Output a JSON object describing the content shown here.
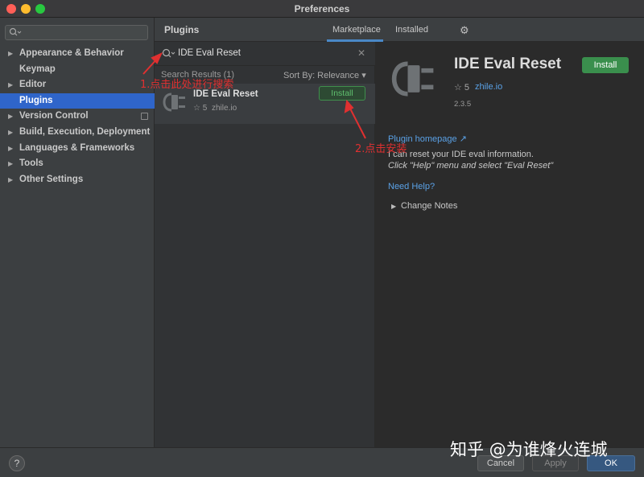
{
  "window": {
    "title": "Preferences"
  },
  "sidebar": {
    "search": {
      "value": ""
    },
    "items": [
      {
        "label": "Appearance & Behavior",
        "expandable": true
      },
      {
        "label": "Keymap",
        "expandable": false
      },
      {
        "label": "Editor",
        "expandable": true
      },
      {
        "label": "Plugins",
        "expandable": false,
        "active": true
      },
      {
        "label": "Version Control",
        "expandable": true
      },
      {
        "label": "Build, Execution, Deployment",
        "expandable": true
      },
      {
        "label": "Languages & Frameworks",
        "expandable": true
      },
      {
        "label": "Tools",
        "expandable": true
      },
      {
        "label": "Other Settings",
        "expandable": true
      }
    ]
  },
  "header": {
    "title": "Plugins",
    "tabs": [
      {
        "label": "Marketplace",
        "active": true
      },
      {
        "label": "Installed",
        "active": false
      }
    ]
  },
  "plugin_search": {
    "value": "IDE Eval Reset"
  },
  "results": {
    "count_label": "Search Results (1)",
    "sort_label": "Sort By: Relevance",
    "items": [
      {
        "name": "IDE Eval Reset",
        "rating": "☆ 5",
        "vendor": "zhile.io",
        "install_label": "Install"
      }
    ]
  },
  "detail": {
    "name": "IDE Eval Reset",
    "install_label": "Install",
    "rating": "☆ 5",
    "vendor": "zhile.io",
    "version": "2.3.5",
    "homepage_label": "Plugin homepage ↗",
    "description_line1": "I can reset your IDE eval information.",
    "description_line2": "Click \"Help\" menu and select \"Eval Reset\"",
    "need_help_label": "Need Help?",
    "change_notes_label": "Change Notes"
  },
  "footer": {
    "help_label": "?",
    "cancel_label": "Cancel",
    "apply_label": "Apply",
    "ok_label": "OK"
  },
  "annotations": {
    "step1": "1.点击此处进行搜索",
    "step2": "2.点击安装"
  },
  "watermark": "知乎 @为谁烽火连城",
  "colors": {
    "accent": "#2f65ca",
    "link": "#5aa1e6",
    "install_green": "#3a8f4d",
    "annotation_red": "#e03030"
  }
}
